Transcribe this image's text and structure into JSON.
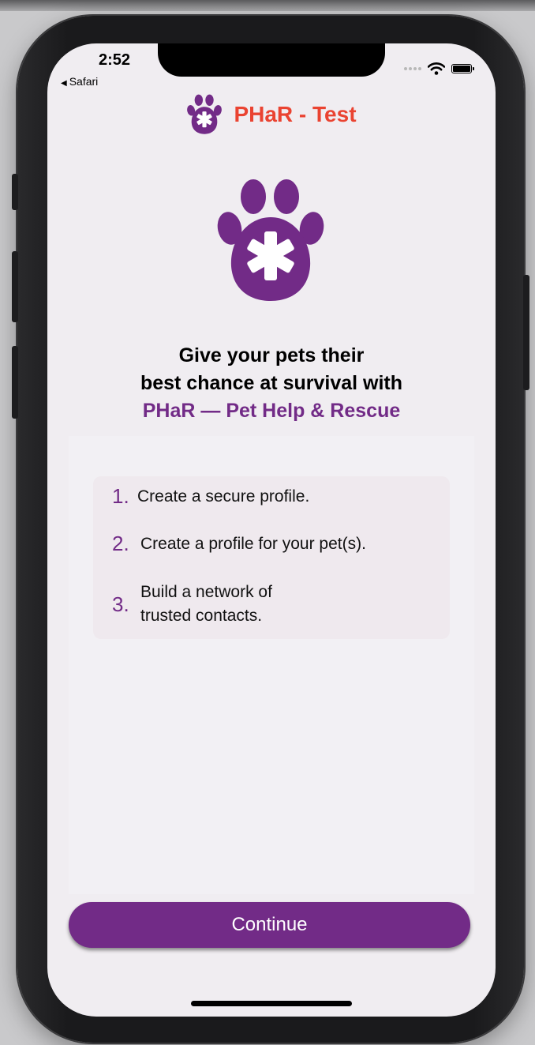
{
  "colors": {
    "brand_purple": "#722b87",
    "title_red": "#ea4331",
    "screen_bg": "#f0edf1"
  },
  "status_bar": {
    "time": "2:52",
    "back_app": "Safari",
    "icons": [
      "cellular-dots-icon",
      "wifi-icon",
      "battery-icon"
    ]
  },
  "nav": {
    "title": "PHaR - Test",
    "logo_icon": "paw-icon"
  },
  "hero": {
    "icon": "paw-icon",
    "line1": "Give your pets their",
    "line2": "best chance at survival with",
    "brand_line": "PHaR — Pet Help & Rescue"
  },
  "steps": [
    {
      "num": "1.",
      "text": "Create a secure profile."
    },
    {
      "num": "2.",
      "text": "Create a profile for your pet(s)."
    },
    {
      "num": "3.",
      "text_line1": "Build a network of",
      "text_line2": "trusted contacts."
    }
  ],
  "actions": {
    "continue_label": "Continue"
  }
}
